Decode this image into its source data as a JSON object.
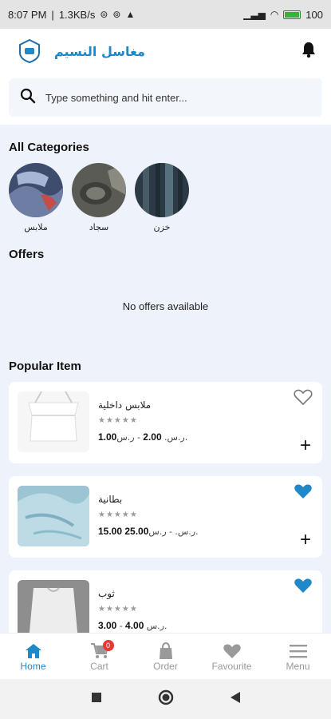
{
  "status": {
    "time": "8:07 PM",
    "speed": "1.3KB/s",
    "battery": "100"
  },
  "header": {
    "brand": "مغاسل النسيم"
  },
  "search": {
    "placeholder": "Type something and hit enter..."
  },
  "sections": {
    "categories": "All Categories",
    "offers": "Offers",
    "popular": "Popular Item"
  },
  "categories": [
    {
      "label": "ملابس",
      "color": "#4a5a7a"
    },
    {
      "label": "سجاد",
      "color": "#5a5a55"
    },
    {
      "label": "خزن",
      "color": "#2e3e48"
    }
  ],
  "offers": {
    "empty": "No offers available"
  },
  "products": [
    {
      "name": "ملابس داخلية",
      "stars": "★★★★★",
      "price_sale": "1.00",
      "price_regular": "2.00",
      "currency": "ر.س.",
      "favourite": false
    },
    {
      "name": "بطانية",
      "stars": "★★★★★",
      "price_sale": "15.00",
      "price_regular": "25.00",
      "currency": "ر.س.",
      "favourite": true
    },
    {
      "name": "ثوب",
      "stars": "★★★★★",
      "price_sale": "3.00",
      "price_regular": "4.00",
      "currency": "ر.س.",
      "favourite": true
    }
  ],
  "nav": {
    "home": "Home",
    "cart": "Cart",
    "cart_count": "0",
    "order": "Order",
    "favourite": "Favourite",
    "menu": "Menu"
  },
  "colors": {
    "accent": "#1e88c8",
    "badge": "#e53935"
  }
}
